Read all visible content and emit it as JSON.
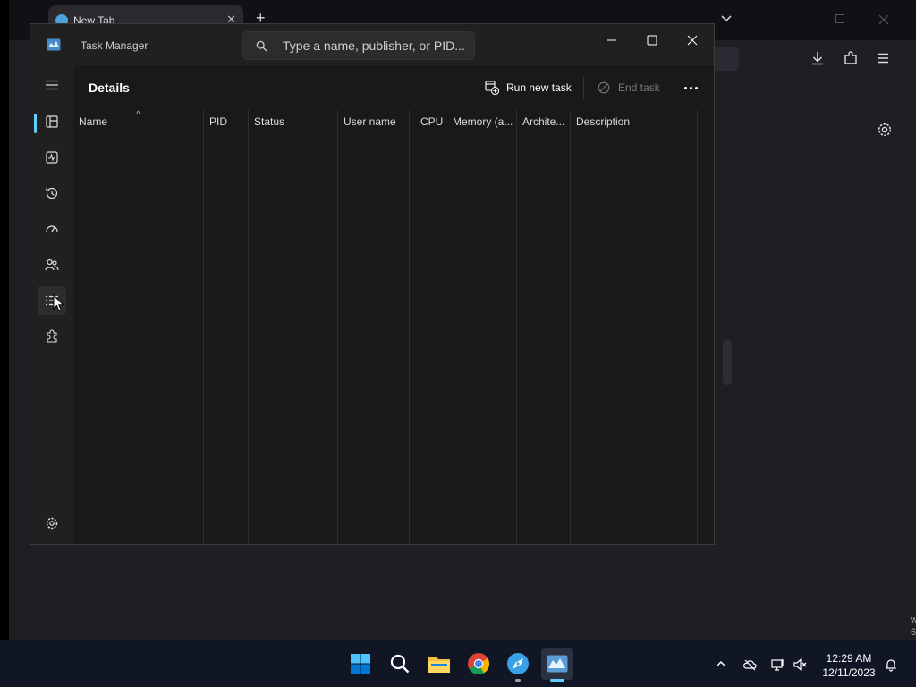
{
  "browser": {
    "tab_title": "New Tab",
    "tab_close": "✕",
    "new_tab": "+",
    "corner_text": "w\n6"
  },
  "task_manager": {
    "title": "Task Manager",
    "search_placeholder": "Type a name, publisher, or PID...",
    "page_title": "Details",
    "run_new_task_label": "Run new task",
    "end_task_label": "End task",
    "columns": [
      "Name",
      "PID",
      "Status",
      "User name",
      "CPU",
      "Memory (a...",
      "Archite...",
      "Description"
    ],
    "sort_indicator": "^",
    "nav_items": [
      "processes",
      "performance",
      "app-history",
      "startup-apps",
      "users",
      "details",
      "services",
      "settings"
    ],
    "active_nav": "details",
    "accent_color": "#60cdff"
  },
  "taskbar": {
    "clock_time": "12:29 AM",
    "clock_date": "12/11/2023",
    "pinned": [
      "start",
      "search",
      "file-explorer",
      "chrome",
      "browser",
      "task-manager"
    ]
  }
}
